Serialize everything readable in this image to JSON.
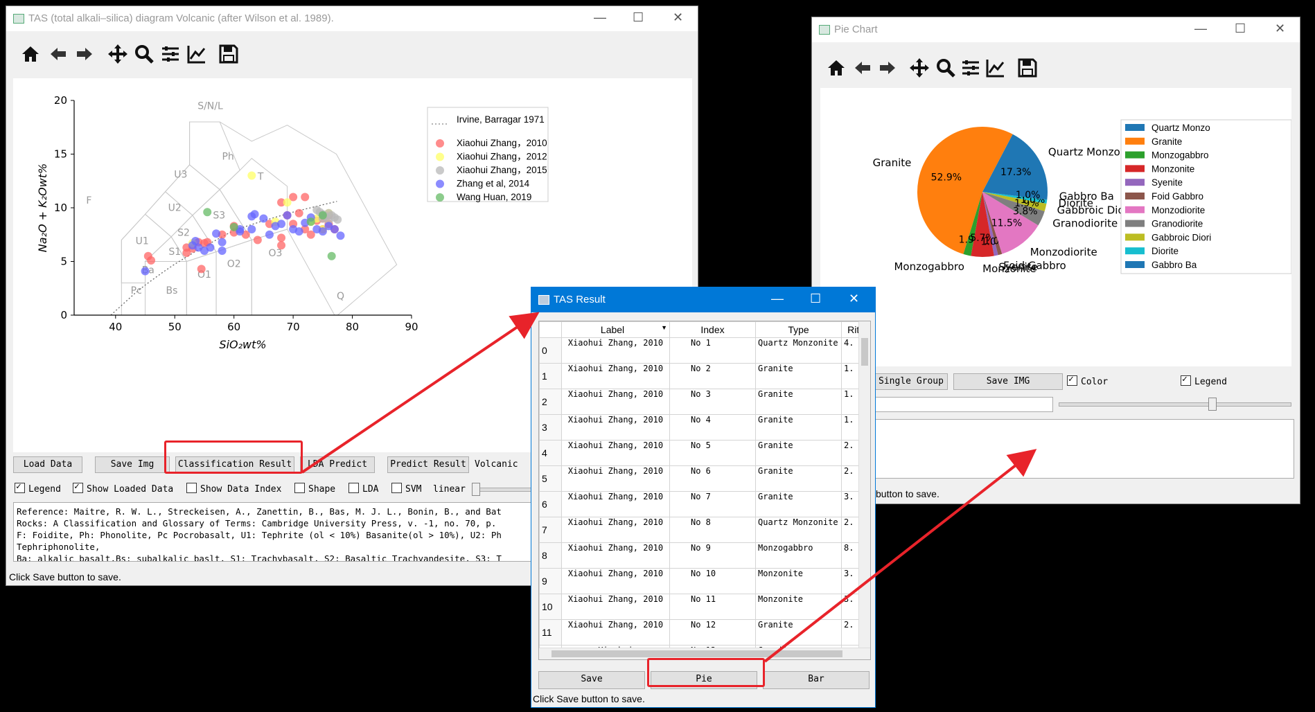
{
  "tas_window": {
    "title": "TAS (total alkali–silica) diagram Volcanic (after Wilson et al. 1989).",
    "buttons": {
      "load": "Load Data",
      "save_img": "Save Img",
      "classification": "Classification Result",
      "lda_predict": "LDA Predict",
      "predict_result": "Predict Result"
    },
    "mode_label": "Volcanic",
    "checkboxes": {
      "legend": "Legend",
      "show_loaded": "Show Loaded Data",
      "show_index": "Show Data Index",
      "shape": "Shape",
      "lda": "LDA",
      "svm": "SVM"
    },
    "scale_label": "linear",
    "reference_text": [
      "Reference: Maitre, R. W. L., Streckeisen, A., Zanettin, B., Bas, M. J. L., Bonin, B., and Bat",
      "Rocks: A Classification and Glossary of Terms: Cambridge University Press, v. -1, no. 70, p.",
      "F: Foidite, Ph: Phonolite, Pc Pocrobasalt, U1: Tephrite (ol < 10%) Basanite(ol > 10%), U2: Ph",
      "Tephriphonolite,",
      "Ba: alkalic basalt,Bs: subalkalic baslt, S1: Trachybasalt, S2: Basaltic Trachyandesite, S3: T"
    ],
    "status": "Click Save button to save.",
    "plot": {
      "xlabel": "SiO₂wt%",
      "ylabel": "Na₂O + K₂Owt%",
      "x_ticks": [
        "40",
        "50",
        "60",
        "70",
        "80",
        "90"
      ],
      "y_ticks": [
        "0",
        "5",
        "10",
        "15",
        "20"
      ],
      "xlim": [
        33,
        90
      ],
      "ylim": [
        0,
        20
      ],
      "field_labels": [
        "S/N/L",
        "Ph",
        "U3",
        "T",
        "F",
        "U2",
        "S3",
        "U1",
        "S2",
        "S1",
        "Ba",
        "O1",
        "O2",
        "O3",
        "Pc",
        "Bs",
        "Q"
      ],
      "legend": [
        "Irvine, Barragar 1971",
        "Xiaohui Zhang，2010",
        "Xiaohui Zhang，2012",
        "Xiaohui Zhang，2015",
        "Zhang et al, 2014",
        "Wang Huan, 2019"
      ],
      "series_colors": [
        "#ff6666",
        "#ffff66",
        "#b8b8b8",
        "#6666ff",
        "#66bb66"
      ],
      "series_points": [
        [
          [
            45.5,
            5.5
          ],
          [
            46,
            5.1
          ],
          [
            52,
            6.3
          ],
          [
            52,
            5.8
          ],
          [
            53,
            6.2
          ],
          [
            54,
            6.8
          ],
          [
            54.5,
            4.3
          ],
          [
            55,
            6.7
          ],
          [
            55.5,
            6.8
          ],
          [
            58,
            7.5
          ],
          [
            60,
            7.7
          ],
          [
            60,
            8.3
          ],
          [
            62,
            7.5
          ],
          [
            64,
            7.0
          ],
          [
            66,
            8.5
          ],
          [
            68,
            7.2
          ],
          [
            68,
            6.5
          ],
          [
            68,
            10.5
          ],
          [
            69,
            9.3
          ],
          [
            70,
            11.0
          ],
          [
            70,
            8.5
          ],
          [
            71,
            9.5
          ],
          [
            72,
            8.0
          ],
          [
            72,
            11.0
          ],
          [
            73,
            7.5
          ],
          [
            74,
            8.8
          ],
          [
            75,
            8.0
          ],
          [
            75,
            9.0
          ],
          [
            76,
            8.5
          ],
          [
            76,
            9.3
          ],
          [
            77,
            8.0
          ]
        ],
        [
          [
            53,
            6.7
          ],
          [
            63,
            13.0
          ],
          [
            67,
            8.7
          ],
          [
            69,
            10.5
          ],
          [
            73,
            8.7
          ],
          [
            74,
            9.0
          ],
          [
            75,
            8.0
          ],
          [
            76,
            9.5
          ]
        ],
        [
          [
            74,
            9.8
          ],
          [
            74.5,
            9.6
          ],
          [
            75,
            9.4
          ],
          [
            75.5,
            9.2
          ],
          [
            76,
            9.5
          ],
          [
            76.5,
            9.3
          ],
          [
            77,
            9.1
          ],
          [
            77.5,
            8.9
          ],
          [
            75,
            9.0
          ],
          [
            76,
            8.8
          ]
        ],
        [
          [
            45,
            4.1
          ],
          [
            53,
            6.5
          ],
          [
            53.5,
            6.9
          ],
          [
            54,
            6.3
          ],
          [
            55,
            6.0
          ],
          [
            56,
            6.3
          ],
          [
            57,
            7.6
          ],
          [
            58,
            6.0
          ],
          [
            58,
            6.8
          ],
          [
            61,
            7.8
          ],
          [
            61,
            8.0
          ],
          [
            63,
            9.2
          ],
          [
            63,
            8.0
          ],
          [
            63.5,
            9.4
          ],
          [
            65,
            9.0
          ],
          [
            66,
            7.5
          ],
          [
            67,
            8.3
          ],
          [
            68,
            8.5
          ],
          [
            69,
            9.3
          ],
          [
            70,
            8.0
          ],
          [
            71,
            7.8
          ],
          [
            72,
            8.6
          ],
          [
            73,
            9.1
          ],
          [
            74,
            8.0
          ],
          [
            75,
            7.8
          ],
          [
            76,
            8.3
          ],
          [
            77,
            8.0
          ],
          [
            78,
            7.4
          ]
        ],
        [
          [
            55.5,
            9.6
          ],
          [
            60,
            8.2
          ],
          [
            73,
            8.7
          ],
          [
            75,
            9.3
          ],
          [
            76.5,
            5.5
          ]
        ]
      ],
      "alkaline_line": [
        [
          39.2,
          0
        ],
        [
          40,
          0.4
        ],
        [
          43.2,
          2
        ],
        [
          45,
          2.8
        ],
        [
          48,
          4
        ],
        [
          50,
          4.75
        ],
        [
          53.7,
          6
        ],
        [
          55,
          6.4
        ],
        [
          57,
          7
        ],
        [
          59,
          7.6
        ],
        [
          60,
          7.9
        ],
        [
          65,
          8.8
        ],
        [
          70,
          9.6
        ],
        [
          74.4,
          10.2
        ],
        [
          77.4,
          10.6
        ]
      ]
    }
  },
  "tas_result": {
    "title": "TAS Result",
    "headers": [
      "Label",
      "Index",
      "Type",
      "Rittm"
    ],
    "rows": [
      {
        "n": "0",
        "label": "Xiaohui Zhang, 2010",
        "index": "No 1",
        "type": "Quartz Monzonite",
        "r": "4."
      },
      {
        "n": "1",
        "label": "Xiaohui Zhang, 2010",
        "index": "No 2",
        "type": "Granite",
        "r": "1."
      },
      {
        "n": "2",
        "label": "Xiaohui Zhang, 2010",
        "index": "No 3",
        "type": "Granite",
        "r": "1."
      },
      {
        "n": "3",
        "label": "Xiaohui Zhang, 2010",
        "index": "No 4",
        "type": "Granite",
        "r": "1."
      },
      {
        "n": "4",
        "label": "Xiaohui Zhang, 2010",
        "index": "No 5",
        "type": "Granite",
        "r": "2."
      },
      {
        "n": "5",
        "label": "Xiaohui Zhang, 2010",
        "index": "No 6",
        "type": "Granite",
        "r": "2."
      },
      {
        "n": "6",
        "label": "Xiaohui Zhang, 2010",
        "index": "No 7",
        "type": "Granite",
        "r": "3."
      },
      {
        "n": "7",
        "label": "Xiaohui Zhang, 2010",
        "index": "No 8",
        "type": "Quartz Monzonite",
        "r": "2."
      },
      {
        "n": "8",
        "label": "Xiaohui Zhang, 2010",
        "index": "No 9",
        "type": "Monzogabbro",
        "r": "8."
      },
      {
        "n": "9",
        "label": "Xiaohui Zhang, 2010",
        "index": "No 10",
        "type": "Monzonite",
        "r": "3."
      },
      {
        "n": "10",
        "label": "Xiaohui Zhang, 2010",
        "index": "No 11",
        "type": "Monzonite",
        "r": "3."
      },
      {
        "n": "11",
        "label": "Xiaohui Zhang, 2010",
        "index": "No 12",
        "type": "Granite",
        "r": "2."
      }
    ],
    "partial_row": {
      "label": "Xiaohui",
      "index": "No 13",
      "type": "Granite"
    },
    "buttons": {
      "save": "Save",
      "pie": "Pie",
      "bar": "Bar"
    },
    "status": "Click Save button to save."
  },
  "pie_window": {
    "title": "Pie Chart",
    "buttons": {
      "single_group": "Single Group",
      "save_img": "Save IMG"
    },
    "checkboxes": {
      "color": "Color",
      "legend": "Legend"
    },
    "status_partial": "button to save.",
    "chart_data": {
      "type": "pie",
      "categories": [
        "Quartz Monzonite",
        "Granite",
        "Monzogabbro",
        "Monzonite",
        "Syenite",
        "Foid Gabbro",
        "Monzodiorite",
        "Granodiorite",
        "Gabbroic Diorite",
        "Diorite",
        "Gabbro Ba"
      ],
      "values": [
        17.3,
        52.9,
        1.9,
        5.7,
        1.0,
        1.0,
        11.5,
        3.8,
        1.9,
        1.0,
        1.9
      ],
      "colors": [
        "#1f77b4",
        "#ff7f0e",
        "#2ca02c",
        "#d62728",
        "#9467bd",
        "#8c564b",
        "#e377c2",
        "#7f7f7f",
        "#bcbd22",
        "#17becf",
        "#1f77b4"
      ],
      "slice_labels": [
        "Quartz Monzon",
        "Granite",
        "Monzogabbro",
        "Monzonite",
        "Syenite",
        "Foid Gabbro",
        "Monzodiorite",
        "Granodiorite",
        "Gabbroic Diorite",
        "Diorite",
        "Gabbro Ba"
      ],
      "pct_labels": [
        "17.3%",
        "52.9%",
        "1.9%",
        "5.7%",
        "1.0%",
        "1.0%",
        "11.5%",
        "3.8%",
        "1.9%",
        "1.0%",
        "1.0%"
      ],
      "legend": [
        "Quartz Monzo",
        "Granite",
        "Monzogabbro",
        "Monzonite",
        "Syenite",
        "Foid Gabbro",
        "Monzodiorite",
        "Granodiorite",
        "Gabbroic Diori",
        "Diorite",
        "Gabbro Ba"
      ],
      "legend_placement": "right"
    }
  },
  "annotation_color": "#e8232a"
}
